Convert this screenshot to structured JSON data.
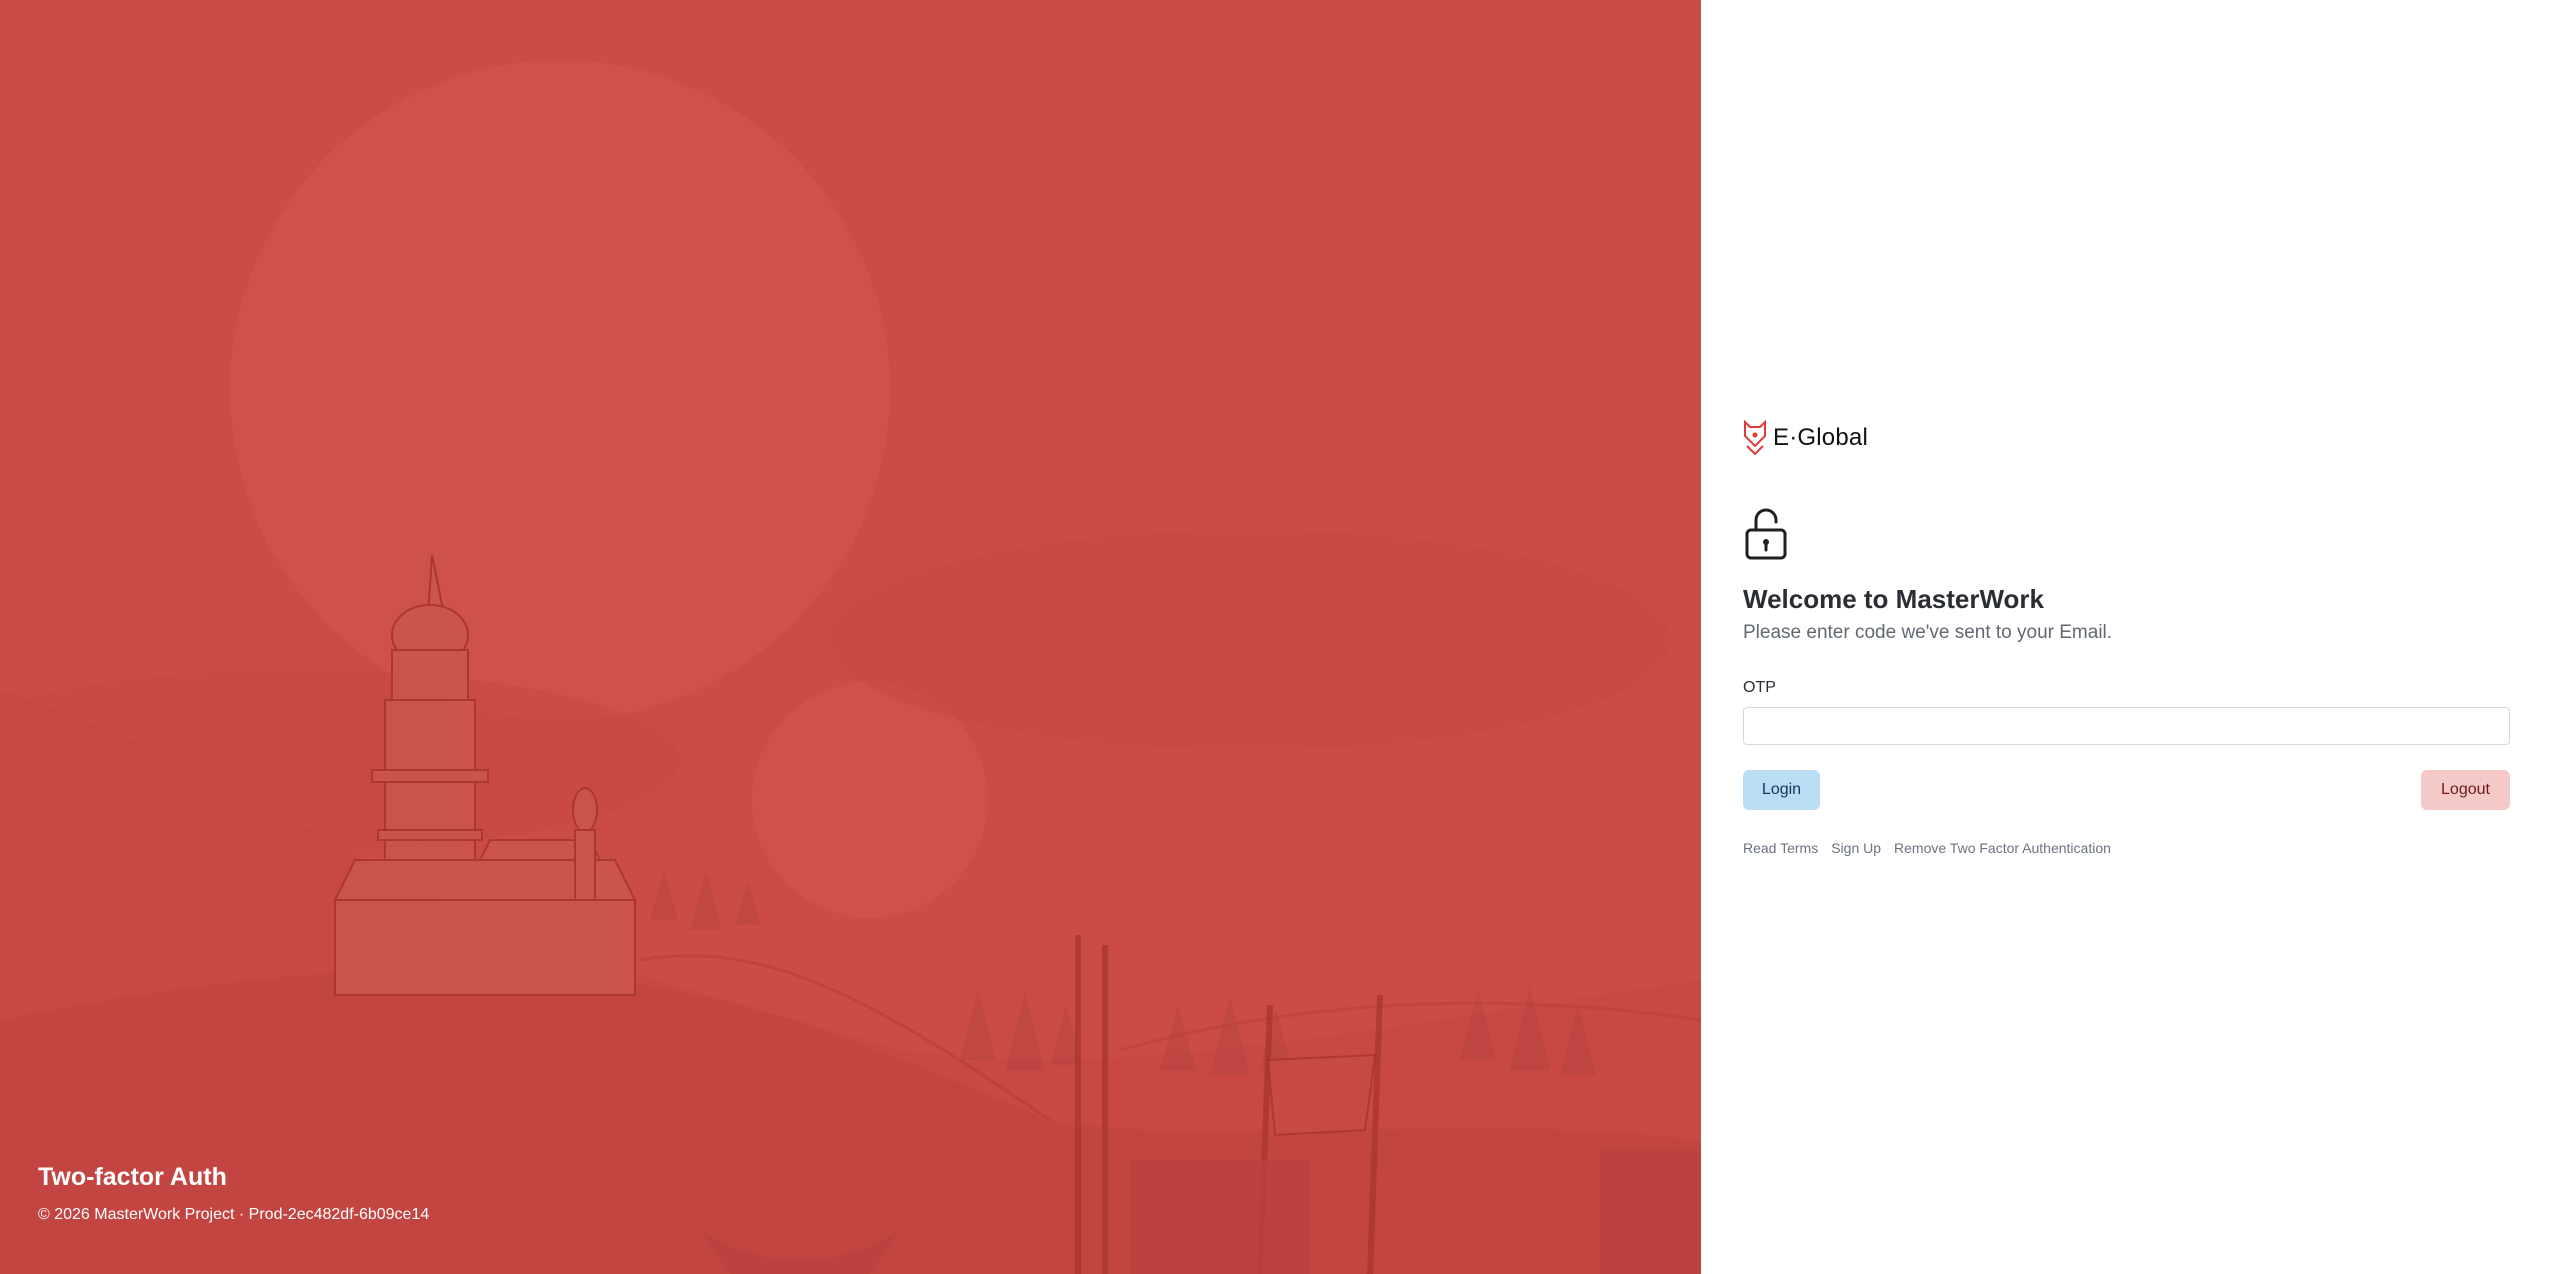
{
  "hero": {
    "title": "Two-factor Auth",
    "copyright": "© 2026 MasterWork Project · Prod-2ec482df-6b09ce14",
    "background_color": "#cb4c47"
  },
  "brand": {
    "name": "E·Global",
    "logo_icon": "fox-head-logo",
    "accent_color": "#e03b3b"
  },
  "auth": {
    "lock_icon": "lock-open-icon",
    "title": "Welcome to MasterWork",
    "subtitle": "Please enter code we've sent to your Email.",
    "otp_label": "OTP",
    "otp_value": "",
    "login_label": "Login",
    "logout_label": "Logout"
  },
  "links": [
    {
      "label": "Read Terms"
    },
    {
      "label": "Sign Up"
    },
    {
      "label": "Remove Two Factor Authentication"
    }
  ]
}
